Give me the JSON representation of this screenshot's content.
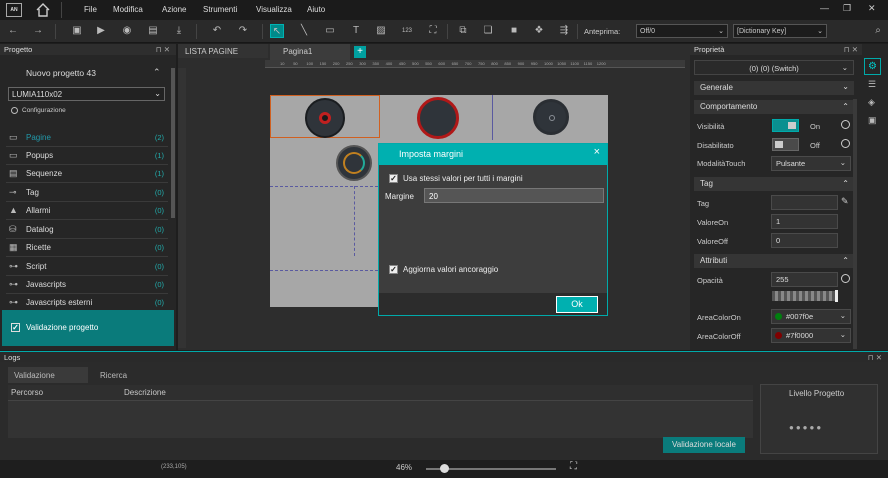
{
  "app": {
    "logo": "AN",
    "menu": [
      "File",
      "Modifica",
      "Azione",
      "Strumenti",
      "Visualizza",
      "Aiuto"
    ]
  },
  "toolbar": {
    "preview_label": "Anteprima:",
    "preview_value": "Off/0",
    "dictionary_value": "[Dictionary Key]",
    "numeric_icon": "123"
  },
  "left": {
    "header": "Progetto",
    "project_name": "Nuovo progetto 43",
    "device": "LUMIA110x02",
    "config": "Configurazione",
    "items": [
      {
        "label": "Pagine",
        "count": "(2)"
      },
      {
        "label": "Popups",
        "count": "(1)"
      },
      {
        "label": "Sequenze",
        "count": "(1)"
      },
      {
        "label": "Tag",
        "count": "(0)"
      },
      {
        "label": "Allarmi",
        "count": "(0)"
      },
      {
        "label": "Datalog",
        "count": "(0)"
      },
      {
        "label": "Ricette",
        "count": "(0)"
      },
      {
        "label": "Script",
        "count": "(0)"
      },
      {
        "label": "Javascripts",
        "count": "(0)"
      },
      {
        "label": "Javascripts esterni",
        "count": "(0)"
      }
    ],
    "validation": "Validazione progetto"
  },
  "tabs": {
    "list": "LISTA PAGINE",
    "page": "Pagina1",
    "add": "+"
  },
  "ruler": [
    "10",
    "50",
    "100",
    "150",
    "200",
    "250",
    "300",
    "350",
    "400",
    "450",
    "500",
    "550",
    "600",
    "650",
    "700",
    "750",
    "800",
    "850",
    "900",
    "950",
    "1000",
    "1050",
    "1100",
    "1150",
    "1200"
  ],
  "dialog": {
    "title": "Imposta margini",
    "same_values": "Usa stessi valori per tutti i margini",
    "margin_label": "Margine",
    "margin_value": "20",
    "update_anchor": "Aggiorna valori ancoraggio",
    "ok": "Ok"
  },
  "right": {
    "header": "Proprietà",
    "selection": "(0) (0) (Switch)",
    "sections": {
      "general": "Generale",
      "behavior": "Comportamento",
      "tag": "Tag",
      "attributes": "Attributi"
    },
    "visibility_label": "Visibilità",
    "visibility_state": "On",
    "disabled_label": "Disabilitato",
    "disabled_state": "Off",
    "touch_label": "ModalitàTouch",
    "touch_value": "Pulsante",
    "tag_label": "Tag",
    "tag_value": "",
    "value_on_label": "ValoreOn",
    "value_on": "1",
    "value_off_label": "ValoreOff",
    "value_off": "0",
    "opacity_label": "Opacità",
    "opacity_value": "255",
    "area_on_label": "AreaColorOn",
    "area_on_value": "#007f0e",
    "area_off_label": "AreaColorOff",
    "area_off_value": "#7f0000"
  },
  "colors": {
    "accent": "#00b0b0",
    "area_on": "#007f0e",
    "area_off": "#7f0000"
  },
  "logs": {
    "header": "Logs",
    "tabs": [
      "Validazione",
      "Ricerca"
    ],
    "col_path": "Percorso",
    "col_desc": "Descrizione",
    "local_validation": "Validazione locale",
    "project_level": "Livello Progetto"
  },
  "status": {
    "coords": "(233,105)",
    "zoom": "46%",
    "zoom_level": 0.46
  }
}
